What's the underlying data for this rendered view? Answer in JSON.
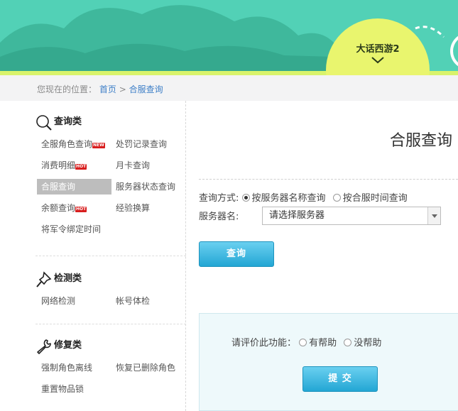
{
  "header": {
    "game_name": "大话西游2",
    "chevron_icon": "chevron-down-icon"
  },
  "breadcrumb": {
    "prefix": "您现在的位置：",
    "home": "首页",
    "separator": ">",
    "current": "合服查询"
  },
  "sidebar": {
    "sections": [
      {
        "title": "查询类",
        "icon": "search-icon",
        "items": [
          {
            "label": "全服角色查询",
            "badge": "NEW"
          },
          {
            "label": "处罚记录查询",
            "badge": ""
          },
          {
            "label": "消费明细",
            "badge": "HOT"
          },
          {
            "label": "月卡查询",
            "badge": ""
          },
          {
            "label": "合服查询",
            "badge": "",
            "active": true
          },
          {
            "label": "服务器状态查询",
            "badge": ""
          },
          {
            "label": "余额查询",
            "badge": "HOT"
          },
          {
            "label": "经验换算",
            "badge": ""
          },
          {
            "label": "将军令绑定时间",
            "badge": ""
          }
        ]
      },
      {
        "title": "检测类",
        "icon": "pin-icon",
        "items": [
          {
            "label": "网络检测",
            "badge": ""
          },
          {
            "label": "帐号体检",
            "badge": ""
          }
        ]
      },
      {
        "title": "修复类",
        "icon": "wrench-icon",
        "items": [
          {
            "label": "强制角色离线",
            "badge": ""
          },
          {
            "label": "恢复已删除角色",
            "badge": ""
          },
          {
            "label": "重置物品锁",
            "badge": ""
          }
        ]
      }
    ]
  },
  "main": {
    "title": "合服查询",
    "query_mode_label": "查询方式:",
    "query_modes": [
      {
        "label": "按服务器名称查询",
        "selected": true
      },
      {
        "label": "按合服时间查询",
        "selected": false
      }
    ],
    "server_label": "服务器名:",
    "server_select_value": "请选择服务器",
    "query_button": "查询"
  },
  "feedback": {
    "question": "请评价此功能：",
    "options": [
      {
        "label": "有帮助",
        "selected": false
      },
      {
        "label": "没帮助",
        "selected": false
      }
    ],
    "submit_button": "提 交"
  },
  "colors": {
    "banner": "#4ccfb5",
    "game_tab": "#e9f56e",
    "link": "#3e7fc7",
    "button": "#23a6d4",
    "badge": "#d81e1e"
  }
}
